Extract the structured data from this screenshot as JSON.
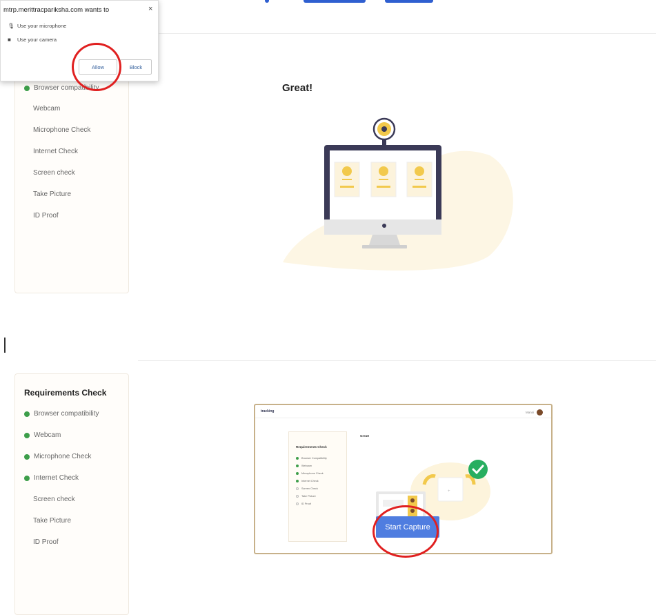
{
  "popup": {
    "site_text": "mtrp.merittracpariksha.com wants to",
    "close_glyph": "×",
    "permissions": [
      {
        "icon": "microphone-icon",
        "label": "Use your microphone"
      },
      {
        "icon": "camera-icon",
        "label": "Use your camera"
      }
    ],
    "allow_label": "Allow",
    "block_label": "Block"
  },
  "section1": {
    "sidebar_items": [
      {
        "label": "Browser compatibility",
        "checked": true
      },
      {
        "label": "Webcam",
        "checked": false
      },
      {
        "label": "Microphone Check",
        "checked": false
      },
      {
        "label": "Internet Check",
        "checked": false
      },
      {
        "label": "Screen check",
        "checked": false
      },
      {
        "label": "Take Picture",
        "checked": false
      },
      {
        "label": "ID Proof",
        "checked": false
      }
    ],
    "greeting": "Great!"
  },
  "section2": {
    "sidebar_title": "Requirements Check",
    "sidebar_items": [
      {
        "label": "Browser compatibility",
        "checked": true
      },
      {
        "label": "Webcam",
        "checked": true
      },
      {
        "label": "Microphone Check",
        "checked": true
      },
      {
        "label": "Internet Check",
        "checked": true
      },
      {
        "label": "Screen check",
        "checked": false
      },
      {
        "label": "Take Picture",
        "checked": false
      },
      {
        "label": "ID Proof",
        "checked": false
      }
    ],
    "preview": {
      "logo": "tracking",
      "user": "Mansi",
      "great": "Great!",
      "sidebar_title": "Requirements Check",
      "items": [
        {
          "label": "Browser Compatibility",
          "checked": true
        },
        {
          "label": "Webcam",
          "checked": true
        },
        {
          "label": "Microphone Check",
          "checked": true
        },
        {
          "label": "Internet Check",
          "checked": true
        },
        {
          "label": "Screen Check",
          "checked": false
        },
        {
          "label": "Take Picture",
          "checked": false
        },
        {
          "label": "ID Proof",
          "checked": false
        }
      ]
    },
    "start_capture_label": "Start Capture"
  },
  "colors": {
    "accent_blue": "#4f7de0",
    "check_green": "#3d9e4a",
    "highlight_red": "#e02020",
    "monitor_frame": "#3b3a57",
    "illustration_yellow": "#f2c94c"
  }
}
